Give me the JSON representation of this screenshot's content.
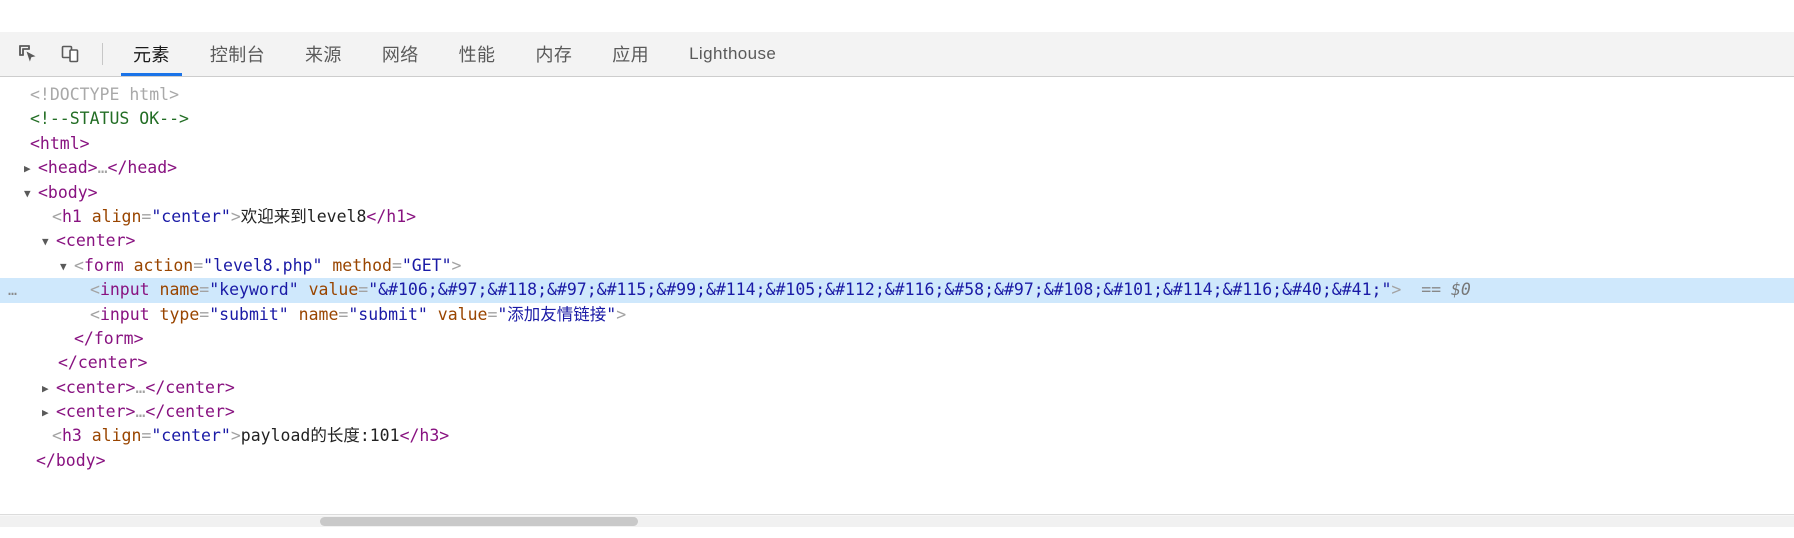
{
  "toolbar": {
    "icons": [
      {
        "name": "inspect-element-icon",
        "title": "检查元素"
      },
      {
        "name": "device-toolbar-icon",
        "title": "切换设备工具栏"
      }
    ],
    "tabs": [
      {
        "label": "元素",
        "active": true,
        "latin": false
      },
      {
        "label": "控制台",
        "active": false,
        "latin": false
      },
      {
        "label": "来源",
        "active": false,
        "latin": false
      },
      {
        "label": "网络",
        "active": false,
        "latin": false
      },
      {
        "label": "性能",
        "active": false,
        "latin": false
      },
      {
        "label": "内存",
        "active": false,
        "latin": false
      },
      {
        "label": "应用",
        "active": false,
        "latin": false
      },
      {
        "label": "Lighthouse",
        "active": false,
        "latin": true
      }
    ]
  },
  "dom": {
    "doctype": "<!DOCTYPE html>",
    "comment": "<!--STATUS OK-->",
    "html_open": "<html>",
    "head_collapsed_open": "<head>",
    "head_collapsed_ellipsis": "…",
    "head_collapsed_close": "</head>",
    "body_open": "<body>",
    "h1": {
      "open_lt": "<",
      "tag": "h1",
      "attr_name": "align",
      "attr_eq": "=",
      "attr_value": "\"center\"",
      "open_gt": ">",
      "text": "欢迎来到level8",
      "close": "</h1>"
    },
    "center_open": "<center>",
    "form": {
      "open_lt": "<",
      "tag": "form",
      "attr1_name": "action",
      "attr1_value": "\"level8.php\"",
      "attr2_name": "method",
      "attr2_value": "\"GET\"",
      "open_gt": ">"
    },
    "input_keyword": {
      "gutter": "…",
      "open_lt": "<",
      "tag": "input",
      "attr1_name": "name",
      "attr1_value": "\"keyword\"",
      "attr2_name": "value",
      "attr2_value": "\"&#106;&#97;&#118;&#97;&#115;&#99;&#114;&#105;&#112;&#116;&#58;&#97;&#108;&#101;&#114;&#116;&#40;&#41;\"",
      "open_gt": ">",
      "selected_marker_eq": "==",
      "selected_marker": "$0"
    },
    "input_submit": {
      "open_lt": "<",
      "tag": "input",
      "attr1_name": "type",
      "attr1_value": "\"submit\"",
      "attr2_name": "name",
      "attr2_value": "\"submit\"",
      "attr3_name": "value",
      "attr3_value": "\"添加友情链接\"",
      "open_gt": ">"
    },
    "form_close": "</form>",
    "center_close": "</center>",
    "center_collapsed_a_open": "<center>",
    "center_collapsed_a_ellipsis": "…",
    "center_collapsed_a_close": "</center>",
    "center_collapsed_b_open": "<center>",
    "center_collapsed_b_ellipsis": "…",
    "center_collapsed_b_close": "</center>",
    "h3": {
      "open_lt": "<",
      "tag": "h3",
      "attr_name": "align",
      "attr_eq": "=",
      "attr_value": "\"center\"",
      "open_gt": ">",
      "text": "payload的长度:101",
      "close": "</h3>"
    },
    "body_close": "</body>"
  },
  "colors": {
    "accent": "#1a73e8",
    "selection": "#cfe8fc",
    "tag": "#881280",
    "attr_name": "#994500",
    "attr_value": "#1a1aa6",
    "comment": "#236e25",
    "toolbar_bg": "#f3f3f3"
  }
}
